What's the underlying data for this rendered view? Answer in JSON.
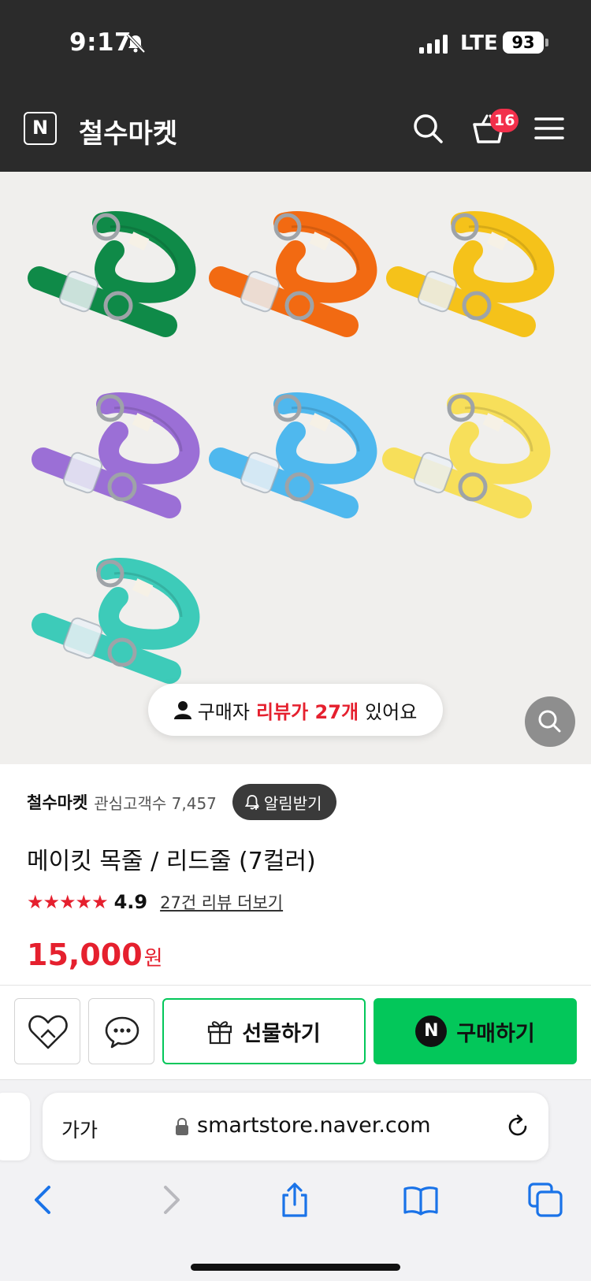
{
  "status": {
    "time": "9:17",
    "network": "LTE",
    "battery": "93"
  },
  "header": {
    "logo": "N",
    "title": "철수마켓",
    "cart_count": "16"
  },
  "hero": {
    "review_pill": {
      "prefix": "구매자",
      "highlight": "리뷰가 27개",
      "suffix": "있어요"
    },
    "leash_colors": [
      "#0f8a48",
      "#f26a12",
      "#f5c21a",
      "#9b6fd6",
      "#4fb8ee",
      "#f7df5a",
      "#3dcbb9"
    ]
  },
  "store": {
    "name": "철수마켓",
    "followers": "관심고객수 7,457",
    "alarm_label": "알림받기"
  },
  "product": {
    "name": "메이킷 목줄 / 리드줄 (7컬러)",
    "stars": "★★★★★",
    "rating": "4.9",
    "review_link": "27건 리뷰 더보기",
    "price": "15,000",
    "price_unit": "원"
  },
  "buybar": {
    "gift_label": "선물하기",
    "buy_label": "구매하기",
    "buy_logo": "N"
  },
  "safari": {
    "text_size": "가가",
    "url": "smartstore.naver.com"
  },
  "colors": {
    "accent_red": "#e5202e",
    "naver_green": "#03c75a",
    "header_bg": "#2b2b2b"
  }
}
